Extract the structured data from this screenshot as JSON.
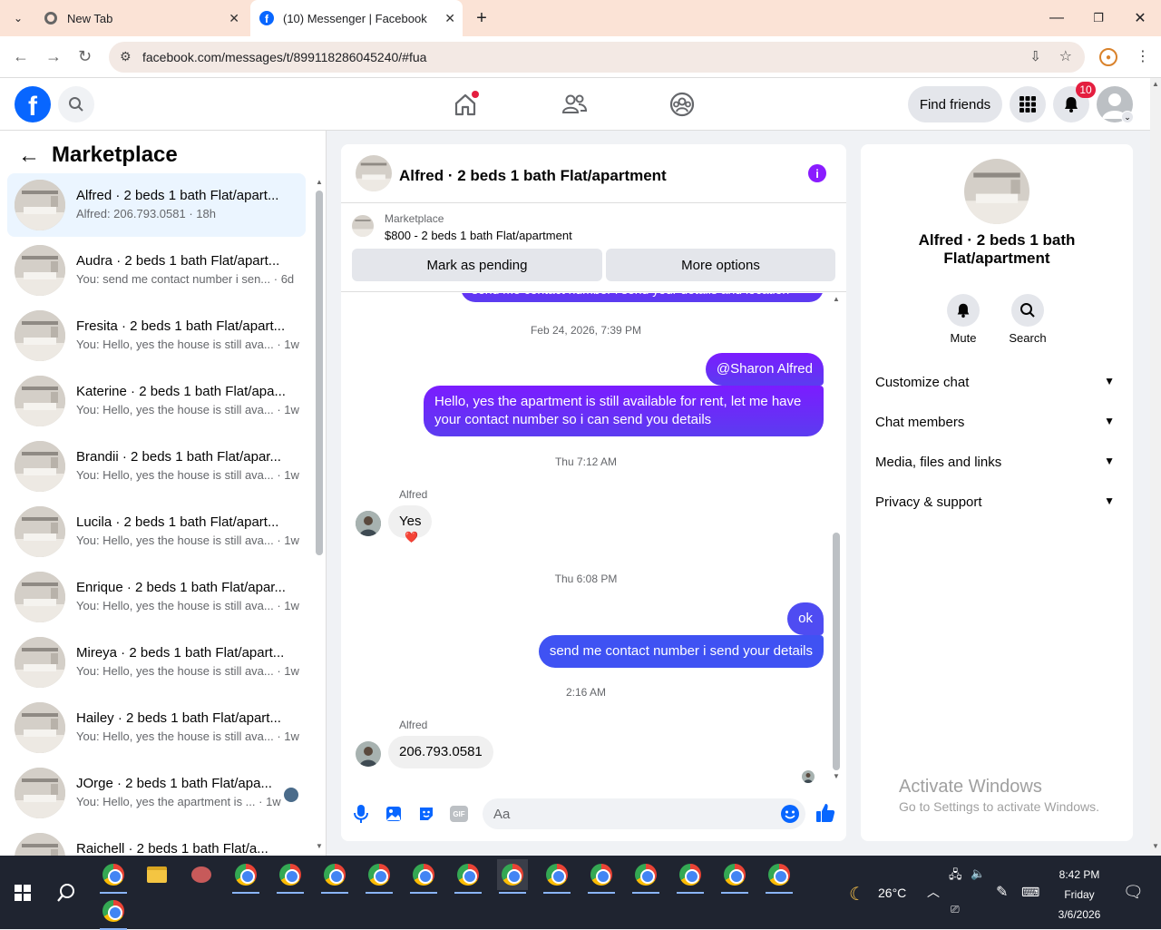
{
  "browser": {
    "tabs": [
      {
        "title": "New Tab"
      },
      {
        "title": "(10) Messenger | Facebook"
      }
    ],
    "url": "facebook.com/messages/t/899118286045240/#fua"
  },
  "fbnav": {
    "find_friends": "Find friends",
    "notif_count": "10"
  },
  "left": {
    "title": "Marketplace",
    "conversations": [
      {
        "name": "Alfred · 2 beds 1 bath Flat/apart...",
        "preview": "Alfred: 206.793.0581 · 18h"
      },
      {
        "name": "Audra · 2 beds 1 bath Flat/apart...",
        "preview": "You: send me contact number i sen... · 6d"
      },
      {
        "name": "Fresita · 2 beds 1 bath Flat/apart...",
        "preview": "You: Hello, yes the house is still ava... · 1w"
      },
      {
        "name": "Katerine · 2 beds 1 bath Flat/apa...",
        "preview": "You: Hello, yes the house is still ava... · 1w"
      },
      {
        "name": "Brandii · 2 beds 1 bath Flat/apar...",
        "preview": "You: Hello, yes the house is still ava... · 1w"
      },
      {
        "name": "Lucila · 2 beds 1 bath Flat/apart...",
        "preview": "You: Hello, yes the house is still ava... · 1w"
      },
      {
        "name": "Enrique · 2 beds 1 bath Flat/apar...",
        "preview": "You: Hello, yes the house is still ava... · 1w"
      },
      {
        "name": "Mireya · 2 beds 1 bath Flat/apart...",
        "preview": "You: Hello, yes the house is still ava... · 1w"
      },
      {
        "name": "Hailey · 2 beds 1 bath Flat/apart...",
        "preview": "You: Hello, yes the house is still ava... · 1w"
      },
      {
        "name": "JOrge · 2 beds 1 bath Flat/apa...",
        "preview": "You: Hello, yes the apartment is ... · 1w"
      },
      {
        "name": "Raichell · 2 beds 1 bath Flat/a...",
        "preview": ""
      }
    ]
  },
  "chat": {
    "header_title": "Alfred · 2 beds 1 bath Flat/apartment",
    "listing_label": "Marketplace",
    "listing_text": "$800 - 2 beds 1 bath Flat/apartment",
    "mark_pending": "Mark as pending",
    "more_options": "More options",
    "partial_msg": "send me contact number i send your details and location",
    "ts1": "Feb 24, 2026, 7:39 PM",
    "mention": "@Sharon Alfred",
    "msg1": "Hello, yes the apartment is still available for rent, let me have your contact number so i can send you details",
    "ts2": "Thu 7:12 AM",
    "sender": "Alfred",
    "msg_yes": "Yes",
    "reaction": "❤️",
    "ts3": "Thu 6:08 PM",
    "msg_ok": "ok",
    "msg_send": "send me contact number i send your details",
    "ts4": "2:16 AM",
    "msg_phone": "206.793.0581",
    "input_placeholder": "Aa"
  },
  "right": {
    "title": "Alfred · 2 beds 1 bath Flat/apartment",
    "mute": "Mute",
    "search": "Search",
    "sections": [
      "Customize chat",
      "Chat members",
      "Media, files and links",
      "Privacy & support"
    ],
    "activate1": "Activate Windows",
    "activate2": "Go to Settings to activate Windows."
  },
  "taskbar": {
    "temp": "26°C",
    "time": "8:42 PM",
    "day": "Friday",
    "date": "3/6/2026"
  },
  "colors": {
    "fb_blue": "#0866ff",
    "messenger_purple": "#8a1cff",
    "notif_red": "#e41e3f"
  }
}
